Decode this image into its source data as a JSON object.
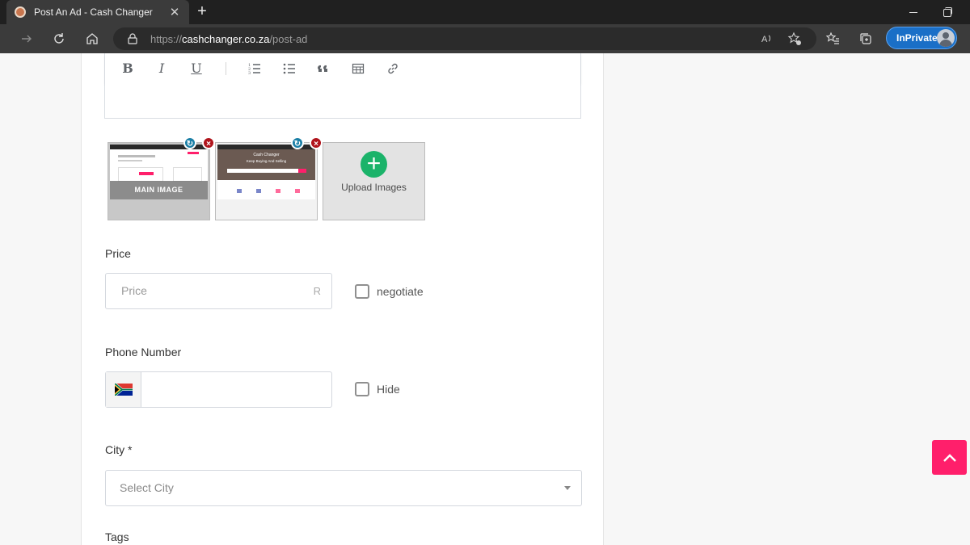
{
  "browser": {
    "tab_title": "Post An Ad - Cash Changer",
    "tab_close": "✕",
    "new_tab": "+",
    "url_scheme": "https://",
    "url_host": "cashchanger.co.za",
    "url_path": "/post-ad",
    "inprivate_label": "InPrivate"
  },
  "editor": {
    "buttons": {
      "bold": "B",
      "italic": "I",
      "underline": "U",
      "icons": [
        "ordered-list-icon",
        "unordered-list-icon",
        "blockquote-icon",
        "table-icon",
        "link-icon"
      ]
    }
  },
  "images": {
    "main_label": "MAIN IMAGE",
    "thumb2_title": "Cash Changer",
    "thumb2_subtitle": "Keep Buying And Selling",
    "upload_label": "Upload Images"
  },
  "form": {
    "price_label": "Price",
    "price_placeholder": "Price",
    "price_suffix": "R",
    "negotiate_label": "negotiate",
    "phone_label": "Phone Number",
    "hide_label": "Hide",
    "city_label": "City *",
    "city_placeholder": "Select City",
    "tags_label": "Tags"
  },
  "colors": {
    "accent": "#ff1f6b",
    "inprivate": "#1a6fc7",
    "upload_plus": "#1bb36a",
    "remove_badge": "#b0141c",
    "rotate_badge": "#1b7fa6"
  }
}
